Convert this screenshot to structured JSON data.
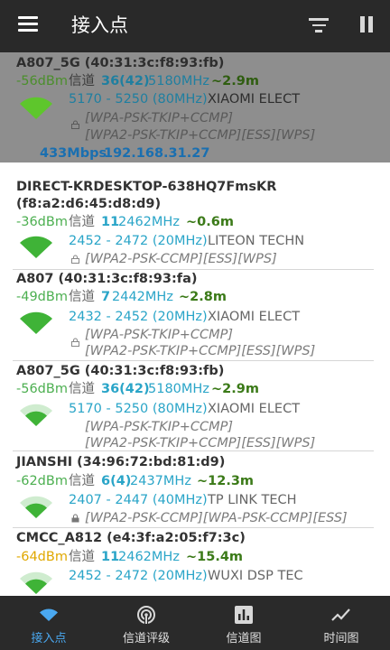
{
  "app_bar": {
    "title": "接入点",
    "menu_icon": "menu-icon",
    "filter_icon": "filter-icon",
    "pause_icon": "pause-icon"
  },
  "connected": {
    "ssid": "A807_5G (40:31:3c:f8:93:fb)",
    "signal": "-56dBm",
    "channel_label": "信道",
    "channel": "36(42)",
    "freq": "5180MHz",
    "distance": "~2.9m",
    "range": "5170 - 5250 (80MHz)",
    "vendor": "XIAOMI ELECT",
    "security_1": "[WPA-PSK-TKIP+CCMP]",
    "security_2": "[WPA2-PSK-TKIP+CCMP][ESS][WPS]",
    "link_speed": "433Mbps",
    "ip": "192.168.31.27"
  },
  "networks": [
    {
      "ssid": "DIRECT-KRDESKTOP-638HQ7FmsKR",
      "bssid": "(f8:a2:d6:45:d8:d9)",
      "signal": "-36dBm",
      "channel_label": "信道",
      "channel": "11",
      "freq": "2462MHz",
      "distance": "~0.6m",
      "range": "2452 - 2472 (20MHz)",
      "vendor": "LITEON TECHN",
      "security_1": "[WPA2-PSK-CCMP][ESS][WPS]"
    },
    {
      "ssid": "A807 (40:31:3c:f8:93:fa)",
      "signal": "-49dBm",
      "channel_label": "信道",
      "channel": "7",
      "freq": "2442MHz",
      "distance": "~2.8m",
      "range": "2432 - 2452 (20MHz)",
      "vendor": "XIAOMI ELECT",
      "security_1": "[WPA-PSK-TKIP+CCMP]",
      "security_2": "[WPA2-PSK-TKIP+CCMP][ESS][WPS]"
    },
    {
      "ssid": "A807_5G (40:31:3c:f8:93:fb)",
      "signal": "-56dBm",
      "channel_label": "信道",
      "channel": "36(42)",
      "freq": "5180MHz",
      "distance": "~2.9m",
      "range": "5170 - 5250 (80MHz)",
      "vendor": "XIAOMI ELECT",
      "security_1": "[WPA-PSK-TKIP+CCMP]",
      "security_2": "[WPA2-PSK-TKIP+CCMP][ESS][WPS]"
    },
    {
      "ssid": "JIANSHI (34:96:72:bd:81:d9)",
      "signal": "-62dBm",
      "channel_label": "信道",
      "channel": "6(4)",
      "freq": "2437MHz",
      "distance": "~12.3m",
      "range": "2407 - 2447 (40MHz)",
      "vendor": "TP LINK TECH",
      "security_1": "[WPA2-PSK-CCMP][WPA-PSK-CCMP][ESS]"
    },
    {
      "ssid": "CMCC_A812 (e4:3f:a2:05:f7:3c)",
      "signal": "-64dBm",
      "channel_label": "信道",
      "channel": "11",
      "freq": "2462MHz",
      "distance": "~15.4m",
      "range": "2452 - 2472 (20MHz)",
      "vendor": "WUXI DSP TEC"
    }
  ],
  "bottom_nav": [
    {
      "label": "接入点",
      "icon": "wifi-icon",
      "active": true
    },
    {
      "label": "信道评级",
      "icon": "signal-rating-icon",
      "active": false
    },
    {
      "label": "信道图",
      "icon": "bar-chart-icon",
      "active": false
    },
    {
      "label": "时间图",
      "icon": "line-chart-icon",
      "active": false
    }
  ],
  "colors": {
    "app_bar": "#292929",
    "accent": "#4aa8f0",
    "signal_green": "#4caf50",
    "signal_yellow": "#e0a800",
    "channel_teal": "#2aa5c8"
  }
}
